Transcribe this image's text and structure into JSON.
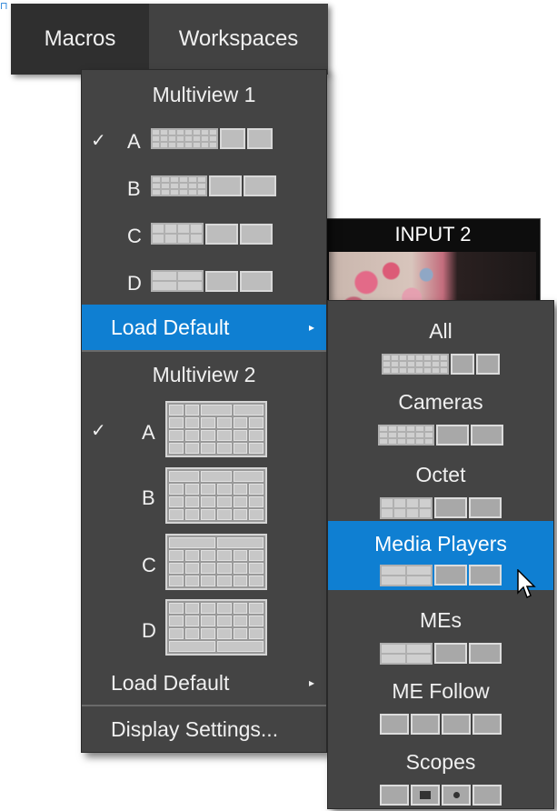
{
  "corner_glyph": "⊓",
  "menubar": {
    "macros": "Macros",
    "workspaces": "Workspaces"
  },
  "monitor": {
    "label": "INPUT 2"
  },
  "dropdown": {
    "multiview1": {
      "title": "Multiview 1",
      "options": [
        {
          "letter": "A",
          "checked": true
        },
        {
          "letter": "B",
          "checked": false
        },
        {
          "letter": "C",
          "checked": false
        },
        {
          "letter": "D",
          "checked": false
        }
      ],
      "load_default": "Load Default"
    },
    "multiview2": {
      "title": "Multiview 2",
      "options": [
        {
          "letter": "A",
          "checked": true
        },
        {
          "letter": "B",
          "checked": false
        },
        {
          "letter": "C",
          "checked": false
        },
        {
          "letter": "D",
          "checked": false
        }
      ],
      "load_default": "Load Default"
    },
    "display_settings": "Display Settings...",
    "check_glyph": "✓",
    "arrow_glyph": "▸"
  },
  "submenu": {
    "items": [
      {
        "label": "All"
      },
      {
        "label": "Cameras"
      },
      {
        "label": "Octet"
      },
      {
        "label": "Media Players",
        "selected": true
      },
      {
        "label": "MEs"
      },
      {
        "label": "ME Follow"
      },
      {
        "label": "Scopes"
      }
    ]
  },
  "colors": {
    "menu_bg": "#444444",
    "highlight": "#0f7fd2",
    "menubar_bg": "#2f2f2f"
  }
}
